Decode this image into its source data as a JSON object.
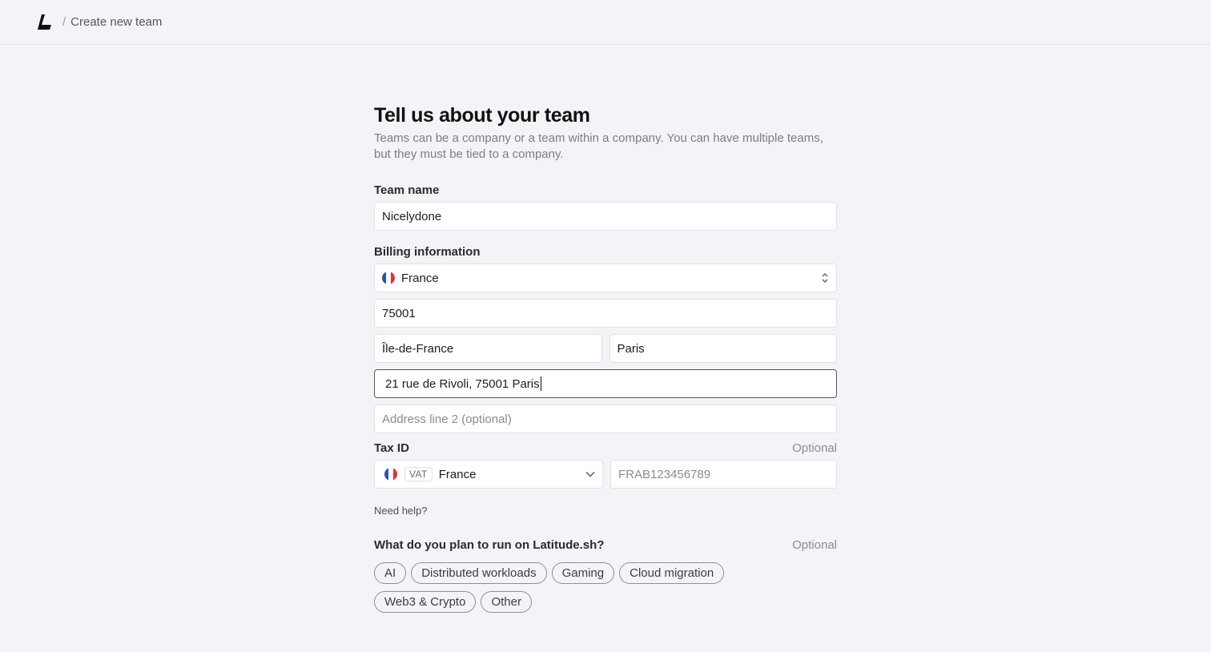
{
  "header": {
    "breadcrumb_separator": "/",
    "breadcrumb_current": "Create new team"
  },
  "form": {
    "title": "Tell us about your team",
    "subtitle": "Teams can be a company or a team within a company. You can have multiple teams, but they must be tied to a company.",
    "team_name": {
      "label": "Team name",
      "value": "Nicelydone"
    },
    "billing": {
      "label": "Billing information",
      "country": "France",
      "postal_code": "75001",
      "region": "Île-de-France",
      "city": "Paris",
      "address_line1": "21 rue de Rivoli, 75001 Paris",
      "address_line2_placeholder": "Address line 2 (optional)"
    },
    "tax": {
      "label": "Tax ID",
      "optional": "Optional",
      "type_badge": "VAT",
      "country": "France",
      "id_placeholder": "FRAB123456789"
    },
    "help_link": "Need help?",
    "plan": {
      "label": "What do you plan to run on Latitude.sh?",
      "optional": "Optional",
      "options": [
        "AI",
        "Distributed workloads",
        "Gaming",
        "Cloud migration",
        "Web3 & Crypto",
        "Other"
      ]
    }
  },
  "colors": {
    "background": "#f3f4f7",
    "flag_blue": "#2d4fb6",
    "flag_red": "#e0323f"
  },
  "icons": {
    "logo": "latitude-logo-icon",
    "country_flag": "france-flag-icon",
    "select_arrows": "chevron-up-down-icon",
    "dropdown": "chevron-down-icon"
  }
}
